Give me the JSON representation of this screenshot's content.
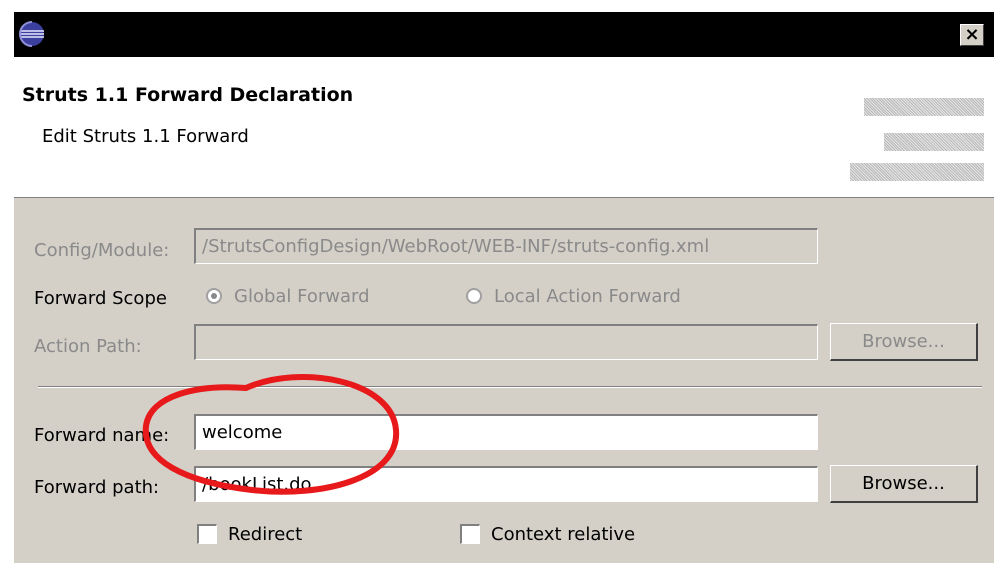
{
  "window": {
    "close_glyph": "×",
    "icon": "eclipse-icon"
  },
  "header": {
    "title": "Struts 1.1 Forward Declaration",
    "description": "Edit Struts 1.1 Forward"
  },
  "form": {
    "config_label": "Config/Module:",
    "config_value": "/StrutsConfigDesign/WebRoot/WEB-INF/struts-config.xml",
    "scope_label": "Forward Scope",
    "scope_options": [
      "Global Forward",
      "Local Action Forward"
    ],
    "scope_selected": "Global Forward",
    "action_path_label": "Action Path:",
    "action_path_value": "",
    "browse_label": "Browse...",
    "forward_name_label": "Forward name:",
    "forward_name_value": "welcome",
    "forward_path_label": "Forward path:",
    "forward_path_value": "/bookList.do",
    "browse2_label": "Browse...",
    "redirect_label": "Redirect",
    "redirect_checked": false,
    "context_relative_label": "Context relative",
    "context_relative_checked": false
  },
  "colors": {
    "dialog_bg": "#d4d0c8",
    "annotation": "#e8191b",
    "disabled_text": "#8a8a8a"
  }
}
